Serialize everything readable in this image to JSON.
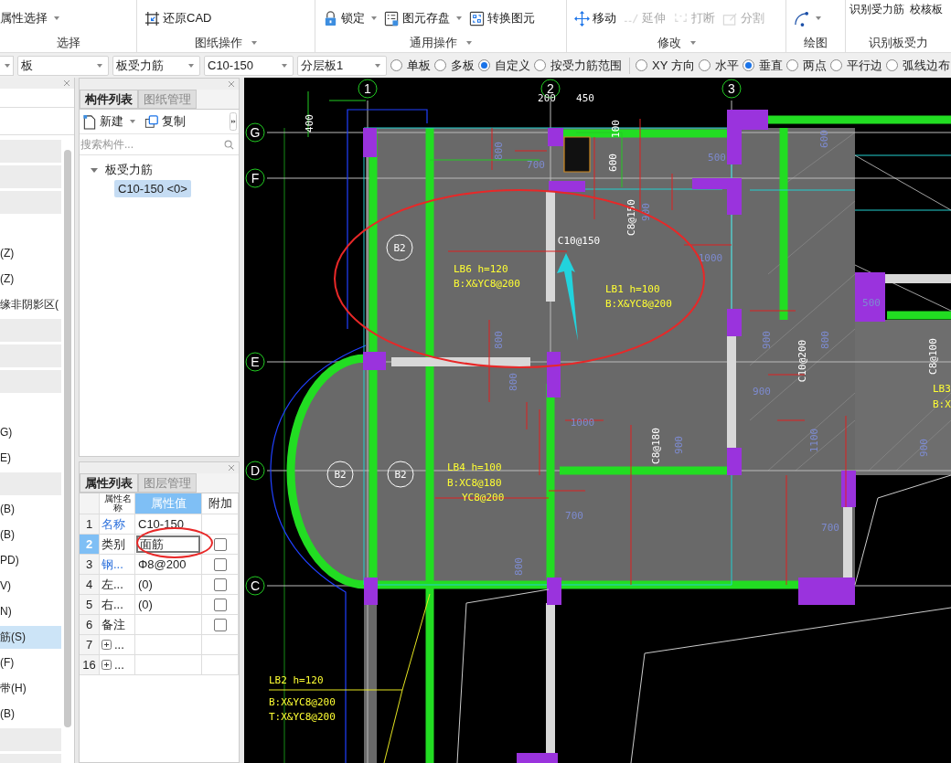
{
  "ribbon": {
    "groups": [
      {
        "label": "选择",
        "menu": false,
        "tools": [
          {
            "label": "属性选择",
            "menu": true,
            "disabled": false
          }
        ]
      },
      {
        "label": "图纸操作",
        "menu": true,
        "tools": [
          {
            "label": "还原CAD",
            "menu": false,
            "disabled": false
          }
        ]
      },
      {
        "label": "通用操作",
        "menu": true,
        "tools": [
          {
            "label": "锁定",
            "menu": true,
            "disabled": false
          },
          {
            "label": "图元存盘",
            "menu": true,
            "disabled": false
          },
          {
            "label": "转换图元",
            "menu": false,
            "disabled": false
          }
        ]
      },
      {
        "label": "修改",
        "menu": true,
        "tools": [
          {
            "label": "移动",
            "menu": false,
            "disabled": false
          },
          {
            "label": "延伸",
            "menu": false,
            "disabled": true
          },
          {
            "label": "打断",
            "menu": false,
            "disabled": true
          },
          {
            "label": "分割",
            "menu": false,
            "disabled": true
          }
        ]
      },
      {
        "label": "绘图",
        "menu": false,
        "tools": [
          {
            "menu": true,
            "disabled": false
          }
        ]
      },
      {
        "label": "识别板受力",
        "menu": false,
        "tools": [
          {
            "label": "识别受力筋",
            "menu": false,
            "disabled": false
          },
          {
            "label": "校核板",
            "menu": false,
            "disabled": false
          }
        ]
      }
    ]
  },
  "options": {
    "selects": [
      {
        "value": "板"
      },
      {
        "value": "板受力筋"
      },
      {
        "value": "C10-150"
      },
      {
        "value": "分层板1"
      }
    ],
    "radio_groups": [
      {
        "options": [
          {
            "label": "单板",
            "selected": false
          },
          {
            "label": "多板",
            "selected": false
          },
          {
            "label": "自定义",
            "selected": true
          },
          {
            "label": "按受力筋范围",
            "selected": false
          }
        ]
      },
      {
        "options": [
          {
            "label": "XY 方向",
            "selected": false
          },
          {
            "label": "水平",
            "selected": false
          },
          {
            "label": "垂直",
            "selected": true
          },
          {
            "label": "两点",
            "selected": false
          },
          {
            "label": "平行边",
            "selected": false
          },
          {
            "label": "弧线边布",
            "selected": false
          }
        ]
      }
    ]
  },
  "left_panel": {
    "items": [
      {
        "kind": "group",
        "selected": false
      },
      {
        "kind": "group",
        "selected": false
      },
      {
        "kind": "group",
        "selected": false
      },
      {
        "kind": "item",
        "selected": false
      },
      {
        "kind": "item",
        "label": "(Z)",
        "selected": false
      },
      {
        "kind": "item",
        "label": "(Z)",
        "selected": false
      },
      {
        "kind": "item",
        "label": "缘非阴影区(",
        "selected": false
      },
      {
        "kind": "group",
        "selected": false
      },
      {
        "kind": "group",
        "selected": false
      },
      {
        "kind": "group",
        "selected": false
      },
      {
        "kind": "item",
        "selected": false
      },
      {
        "kind": "item",
        "label": "G)",
        "selected": false
      },
      {
        "kind": "item",
        "label": "E)",
        "selected": false
      },
      {
        "kind": "group",
        "selected": false
      },
      {
        "kind": "item",
        "label": "(B)",
        "selected": false
      },
      {
        "kind": "item",
        "label": "(B)",
        "selected": false
      },
      {
        "kind": "item",
        "label": "PD)",
        "selected": false
      },
      {
        "kind": "item",
        "label": "V)",
        "selected": false
      },
      {
        "kind": "item",
        "label": "N)",
        "selected": false
      },
      {
        "kind": "item",
        "label": "筋(S)",
        "selected": true
      },
      {
        "kind": "item",
        "label": "(F)",
        "selected": false
      },
      {
        "kind": "item",
        "label": "带(H)",
        "selected": false
      },
      {
        "kind": "item",
        "label": "(B)",
        "selected": false
      },
      {
        "kind": "group",
        "selected": false
      },
      {
        "kind": "group",
        "selected": false
      }
    ]
  },
  "component_panel": {
    "tabs": [
      {
        "label": "构件列表",
        "selected": true
      },
      {
        "label": "图纸管理",
        "selected": false
      }
    ],
    "toolbar": [
      {
        "label": "新建",
        "menu": true
      },
      {
        "label": "复制",
        "menu": false
      }
    ],
    "search": {
      "placeholder": "搜索构件..."
    },
    "tree": [
      {
        "label": "板受力筋",
        "expanded": true,
        "selected": false,
        "children": [
          {
            "label": "C10-150 <0>",
            "selected": true
          }
        ]
      }
    ]
  },
  "property_panel": {
    "tabs": [
      {
        "label": "属性列表",
        "selected": true
      },
      {
        "label": "图层管理",
        "selected": false
      }
    ],
    "columns": [
      "属性名称",
      "属性值",
      "附加"
    ],
    "rows": [
      {
        "num": "1",
        "name": "名称",
        "value": "C10-150",
        "link": true,
        "selected": false
      },
      {
        "num": "2",
        "name": "类别",
        "value": "面筋",
        "link": false,
        "selected": true,
        "checked": false
      },
      {
        "num": "3",
        "name": "钢...",
        "value": "Φ8@200",
        "link": true,
        "selected": false,
        "checked": false
      },
      {
        "num": "4",
        "name": "左...",
        "value": "(0)",
        "link": false,
        "selected": false,
        "checked": false
      },
      {
        "num": "5",
        "name": "右...",
        "value": "(0)",
        "link": false,
        "selected": false,
        "checked": false
      },
      {
        "num": "6",
        "name": "备注",
        "link": false,
        "selected": false,
        "checked": false
      },
      {
        "num": "7",
        "name": "...",
        "link": false,
        "selected": false,
        "expandable": true
      },
      {
        "num": "16",
        "name": "...",
        "link": false,
        "selected": false,
        "expandable": true
      }
    ]
  },
  "cad": {
    "labels": [
      {
        "text": "1",
        "kind": "axis"
      },
      {
        "text": "2",
        "kind": "axis"
      },
      {
        "text": "3",
        "kind": "axis"
      },
      {
        "text": "G",
        "kind": "axis"
      },
      {
        "text": "F",
        "kind": "axis"
      },
      {
        "text": "E",
        "kind": "axis"
      },
      {
        "text": "D",
        "kind": "axis"
      },
      {
        "text": "C",
        "kind": "axis"
      },
      {
        "text": "400",
        "kind": "dimension"
      },
      {
        "text": "200",
        "kind": "dimension"
      },
      {
        "text": "450",
        "kind": "dimension"
      },
      {
        "text": "100",
        "kind": "dimension"
      },
      {
        "text": "600",
        "kind": "dimension"
      },
      {
        "text": "800",
        "kind": "length"
      },
      {
        "text": "700",
        "kind": "length"
      },
      {
        "text": "500",
        "kind": "length"
      },
      {
        "text": "600",
        "kind": "length"
      },
      {
        "text": "C8@150",
        "kind": "rebar"
      },
      {
        "text": "900",
        "kind": "length"
      },
      {
        "text": "C10@150",
        "kind": "rebar"
      },
      {
        "text": "1000",
        "kind": "length"
      },
      {
        "text": "LB6 h=120",
        "kind": "slab"
      },
      {
        "text": "B:X&YC8@200",
        "kind": "slab"
      },
      {
        "text": "LB1 h=100",
        "kind": "slab"
      },
      {
        "text": "B:X&YC8@200",
        "kind": "slab"
      },
      {
        "text": "B2",
        "kind": "tag"
      },
      {
        "text": "500",
        "kind": "length"
      },
      {
        "text": "800",
        "kind": "length"
      },
      {
        "text": "800",
        "kind": "length"
      },
      {
        "text": "900",
        "kind": "length"
      },
      {
        "text": "C10@200",
        "kind": "rebar"
      },
      {
        "text": "800",
        "kind": "length"
      },
      {
        "text": "C8@100",
        "kind": "rebar"
      },
      {
        "text": "900",
        "kind": "length"
      },
      {
        "text": "LB3",
        "kind": "slab"
      },
      {
        "text": "B:X",
        "kind": "slab"
      },
      {
        "text": "1000",
        "kind": "length"
      },
      {
        "text": "C8@180",
        "kind": "rebar"
      },
      {
        "text": "900",
        "kind": "length"
      },
      {
        "text": "1100",
        "kind": "length"
      },
      {
        "text": "900",
        "kind": "length"
      },
      {
        "text": "LB4 h=100",
        "kind": "slab"
      },
      {
        "text": "B:XC8@180",
        "kind": "slab"
      },
      {
        "text": "YC8@200",
        "kind": "slab"
      },
      {
        "text": "B2",
        "kind": "tag"
      },
      {
        "text": "B2",
        "kind": "tag"
      },
      {
        "text": "700",
        "kind": "length"
      },
      {
        "text": "700",
        "kind": "length"
      },
      {
        "text": "800",
        "kind": "length"
      },
      {
        "text": "LB2 h=120",
        "kind": "slab"
      },
      {
        "text": "B:X&YC8@200",
        "kind": "slab"
      },
      {
        "text": "T:X&YC8@200",
        "kind": "slab"
      }
    ]
  }
}
